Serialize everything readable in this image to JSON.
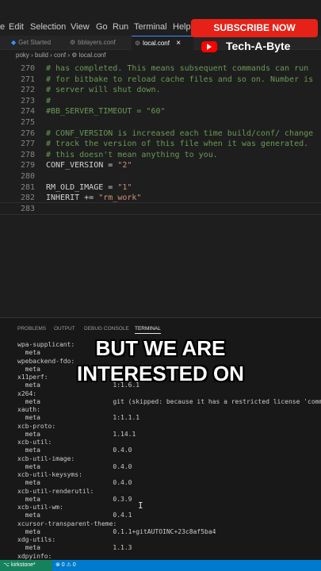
{
  "menu": [
    "e",
    "Edit",
    "Selection",
    "View",
    "Go",
    "Run",
    "Terminal",
    "Help"
  ],
  "tabs": [
    {
      "label": "Get Started",
      "icon": "vscode-icon"
    },
    {
      "label": "bblayers.conf",
      "icon": "gear-icon"
    },
    {
      "label": "local.conf",
      "icon": "gear-icon",
      "close": "×"
    }
  ],
  "breadcrumb": "poky › build › conf › ⚙ local.conf",
  "editor": {
    "line_numbers": [
      "270",
      "271",
      "272",
      "273",
      "274",
      "275",
      "276",
      "277",
      "278",
      "279",
      "280",
      "281",
      "282",
      "283"
    ],
    "lines": [
      {
        "parts": [
          {
            "t": "# has completed. This means subsequent commands can run",
            "c": "cmt"
          }
        ]
      },
      {
        "parts": [
          {
            "t": "# for bitbake to reload cache files and so on. Number is",
            "c": "cmt"
          }
        ]
      },
      {
        "parts": [
          {
            "t": "# server will shut down.",
            "c": "cmt"
          }
        ]
      },
      {
        "parts": [
          {
            "t": "#",
            "c": "cmt"
          }
        ]
      },
      {
        "parts": [
          {
            "t": "#BB_SERVER_TIMEOUT = \"60\"",
            "c": "cmt"
          }
        ]
      },
      {
        "parts": [
          {
            "t": "",
            "c": ""
          }
        ]
      },
      {
        "parts": [
          {
            "t": "# CONF_VERSION is increased each time build/conf/ change",
            "c": "cmt"
          }
        ]
      },
      {
        "parts": [
          {
            "t": "# track the version of this file when it was generated.",
            "c": "cmt"
          }
        ]
      },
      {
        "parts": [
          {
            "t": "# this doesn't mean anything to you.",
            "c": "cmt"
          }
        ]
      },
      {
        "parts": [
          {
            "t": "CONF_VERSION = ",
            "c": ""
          },
          {
            "t": "\"2\"",
            "c": "str"
          }
        ]
      },
      {
        "parts": [
          {
            "t": "",
            "c": ""
          }
        ]
      },
      {
        "parts": [
          {
            "t": "RM_OLD_IMAGE = ",
            "c": ""
          },
          {
            "t": "\"1\"",
            "c": "str"
          }
        ]
      },
      {
        "parts": [
          {
            "t": "INHERIT += ",
            "c": ""
          },
          {
            "t": "\"rm_work\"",
            "c": "str"
          }
        ]
      },
      {
        "parts": [
          {
            "t": "",
            "c": ""
          }
        ]
      }
    ]
  },
  "panel_tabs": [
    "PROBLEMS",
    "OUTPUT",
    "DEBUG CONSOLE",
    "TERMINAL"
  ],
  "terminal_lines": [
    "wpa-supplicant:",
    "  meta",
    "wpebackend-fdo:",
    "  meta",
    "x11perf:",
    "  meta                   1:1.6.1",
    "x264:",
    "  meta                   git (skipped: because it has a restricted license 'commer",
    "xauth:",
    "  meta                   1:1.1.1",
    "xcb-proto:",
    "  meta                   1.14.1",
    "xcb-util:",
    "  meta                   0.4.0",
    "xcb-util-image:",
    "  meta                   0.4.0",
    "xcb-util-keysyms:",
    "  meta                   0.4.0",
    "xcb-util-renderutil:",
    "  meta                   0.3.9",
    "xcb-util-wm:",
    "  meta                   0.4.1",
    "xcursor-transparent-theme:",
    "  meta                   0.1.1+gitAUTOINC+23c8af5ba4",
    "xdg-utils:",
    "  meta                   1.1.3",
    "xdpyinfo:"
  ],
  "status": {
    "left": "⌥ kirkstone*",
    "right": "⊗ 0 ⚠ 0"
  },
  "overlay": {
    "subscribe": "SUBSCRIBE NOW",
    "channel": "Tech-A-Byte",
    "caption_line1": "BUT WE ARE",
    "caption_line2": "INTERESTED ON"
  },
  "colors": {
    "accent": "#007acc",
    "subscribe_red": "#e62117",
    "comment": "#6a9955",
    "string": "#ce9178"
  }
}
